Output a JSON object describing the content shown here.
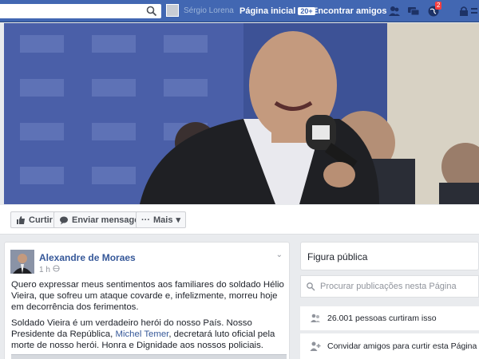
{
  "topbar": {
    "search_placeholder": "",
    "user_name": "Sérgio Lorena",
    "home_label": "Página inicial",
    "home_badge": "20+",
    "find_friends_label": "Encontrar amigos",
    "notifications_count": "2"
  },
  "actions": {
    "like_label": "Curtir",
    "message_label": "Enviar mensagem",
    "more_label": "Mais"
  },
  "post": {
    "author": "Alexandre de Moraes",
    "time": "1 h",
    "paragraph1": "Quero expressar meus sentimentos aos familiares do soldado Hélio Vieira, que sofreu um ataque covarde e, infelizmente, morreu hoje em decorrência dos ferimentos.",
    "paragraph2_before": "Soldado Vieira é um verdadeiro herói do nosso País. Nosso Presidente da República, ",
    "paragraph2_link": "Michel Temer",
    "paragraph2_after": ", decretará luto oficial pela morte de nosso herói. Honra e Dignidade aos nossos policiais."
  },
  "sidebar": {
    "category": "Figura pública",
    "search_placeholder": "Procurar publicações nesta Página",
    "likes_text": "26.001 pessoas curtiram isso",
    "invite_text": "Convidar amigos para curtir esta Página"
  },
  "colors": {
    "brand_blue": "#4267b2",
    "link_blue": "#365899",
    "notification_red": "#fa3e3e"
  }
}
